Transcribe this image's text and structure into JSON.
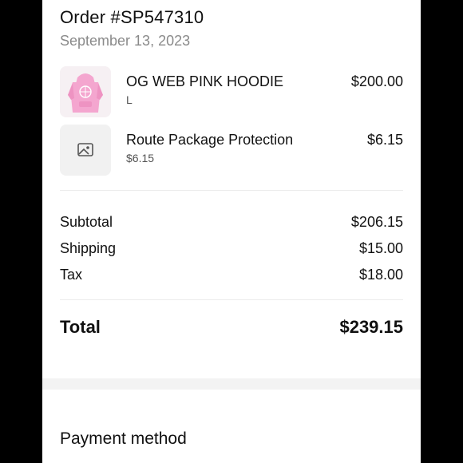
{
  "order": {
    "title": "Order #SP547310",
    "date": "September 13, 2023"
  },
  "items": [
    {
      "name": "OG WEB PINK HOODIE",
      "sub": "L",
      "price": "$200.00",
      "thumb_icon": "pink-hoodie-image"
    },
    {
      "name": "Route Package Protection",
      "sub": "$6.15",
      "price": "$6.15",
      "thumb_icon": "image-placeholder-icon"
    }
  ],
  "summary": {
    "subtotal_label": "Subtotal",
    "subtotal_value": "$206.15",
    "shipping_label": "Shipping",
    "shipping_value": "$15.00",
    "tax_label": "Tax",
    "tax_value": "$18.00",
    "total_label": "Total",
    "total_value": "$239.15"
  },
  "payment": {
    "heading": "Payment method"
  },
  "colors": {
    "hoodie_pink": "#f4a6cf",
    "muted_text": "#8a8a8a"
  }
}
